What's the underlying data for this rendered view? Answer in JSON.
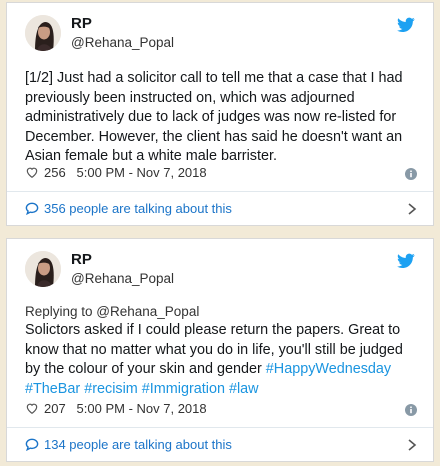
{
  "colors": {
    "link": "#1b95e0",
    "twitter_blue": "#1da1f2",
    "background": "#f2ead7"
  },
  "tweets": [
    {
      "name": "RP",
      "handle": "@Rehana_Popal",
      "text": "[1/2] Just had a solicitor call to tell me that a case that I had previously been instructed on, which was adjourned administratively due to lack of judges was now re-listed for December. However, the client has said he doesn't want an Asian female but a white male barrister.",
      "likes": "256",
      "timestamp": "5:00 PM - Nov 7, 2018",
      "talking": "356 people are talking about this"
    },
    {
      "name": "RP",
      "handle": "@Rehana_Popal",
      "reply_to": "Replying to @Rehana_Popal",
      "text": "Solictors asked if I could please return the papers. Great to know that no matter what you do in life, you'll still be judged by the colour of your skin and gender",
      "hashtags": [
        "#HappyWednesday",
        "#TheBar",
        "#recisim",
        "#Immigration",
        "#law"
      ],
      "likes": "207",
      "timestamp": "5:00 PM - Nov 7, 2018",
      "talking": "134 people are talking about this"
    }
  ]
}
